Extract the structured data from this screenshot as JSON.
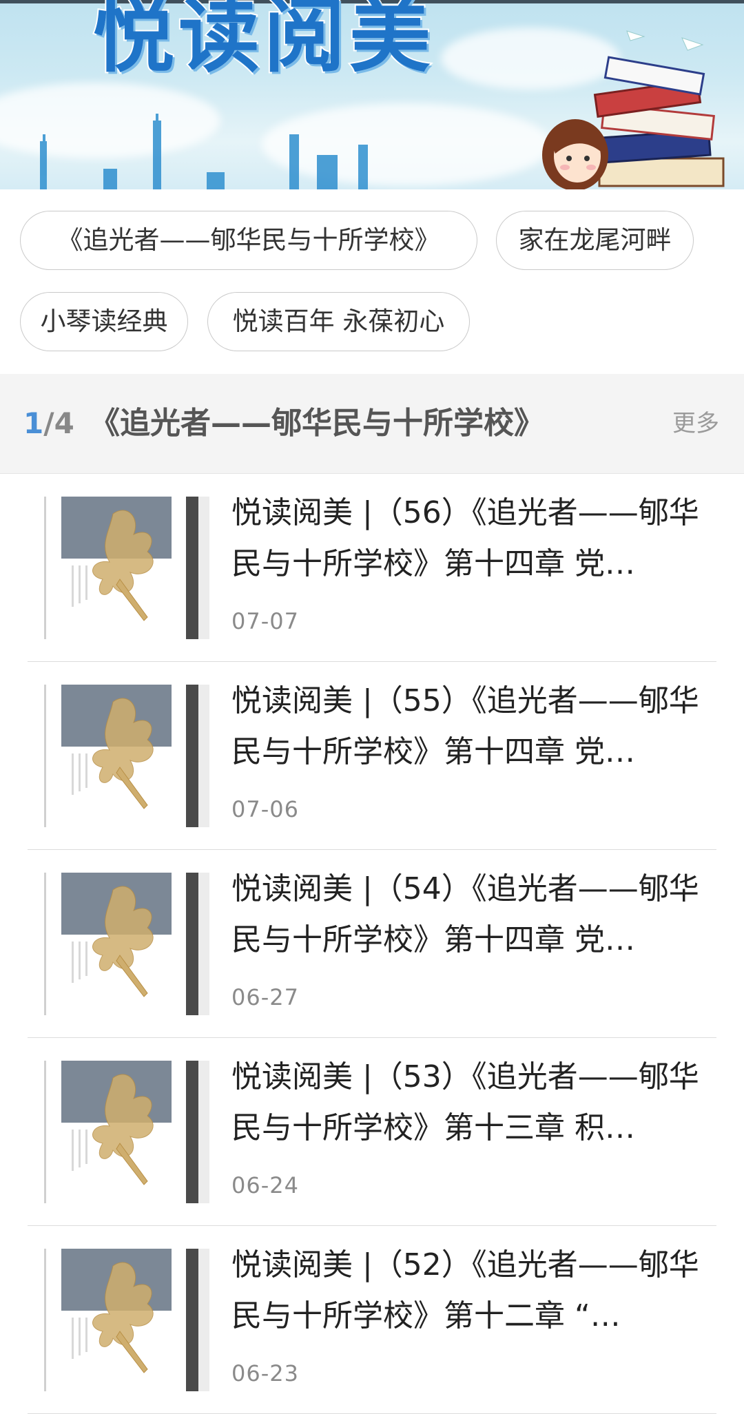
{
  "banner": {
    "title": "悦读阅美"
  },
  "tags": [
    "《追光者——郇华民与十所学校》",
    "家在龙尾河畔",
    "小琴读经典",
    "悦读百年 永葆初心"
  ],
  "section": {
    "current_page": "1",
    "separator_total": "/4",
    "title": "《追光者——郇华民与十所学校》",
    "more_label": "更多"
  },
  "articles": [
    {
      "title": "悦读阅美 |（56）《追光者——郇华民与十所学校》第十四章 党…",
      "date": "07-07"
    },
    {
      "title": "悦读阅美 |（55）《追光者——郇华民与十所学校》第十四章 党…",
      "date": "07-06"
    },
    {
      "title": "悦读阅美 |（54）《追光者——郇华民与十所学校》第十四章 党…",
      "date": "06-27"
    },
    {
      "title": "悦读阅美 |（53）《追光者——郇华民与十所学校》第十三章 积…",
      "date": "06-24"
    },
    {
      "title": "悦读阅美 |（52）《追光者——郇华民与十所学校》第十二章 “…",
      "date": "06-23"
    }
  ],
  "colors": {
    "accent": "#4a8fd6",
    "banner_title": "#1f74c8",
    "section_bg": "#f4f4f4"
  }
}
